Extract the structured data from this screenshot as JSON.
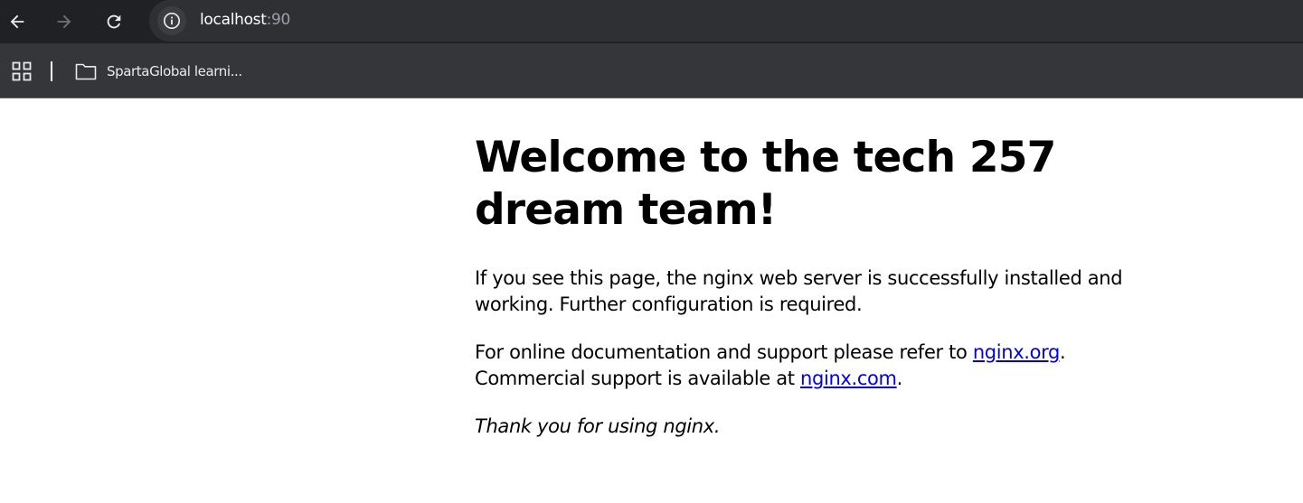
{
  "browser": {
    "url_host": "localhost",
    "url_port": ":90",
    "icons": {
      "back": "arrow-left",
      "forward": "arrow-right",
      "reload": "reload",
      "site_info": "info-circle",
      "apps": "grid",
      "folder": "folder-outline"
    },
    "colors": {
      "toolbar": "#202124",
      "omnibox": "#2f3033",
      "bookmarks_bar": "#35363a"
    }
  },
  "bookmarks": {
    "items": [
      {
        "label": "SpartaGlobal learni..."
      }
    ]
  },
  "page": {
    "title": "Welcome to the tech 257 dream team!",
    "para1": "If you see this page, the nginx web server is successfully installed and working. Further configuration is required.",
    "para2": {
      "text_before": "For online documentation and support please refer to ",
      "link1": "nginx.org",
      "text_middle": ".",
      "text_line2": "Commercial support is available at ",
      "link2": "nginx.com",
      "text_after": "."
    },
    "para3": "Thank you for using nginx.",
    "link_color": "#0000ee"
  }
}
